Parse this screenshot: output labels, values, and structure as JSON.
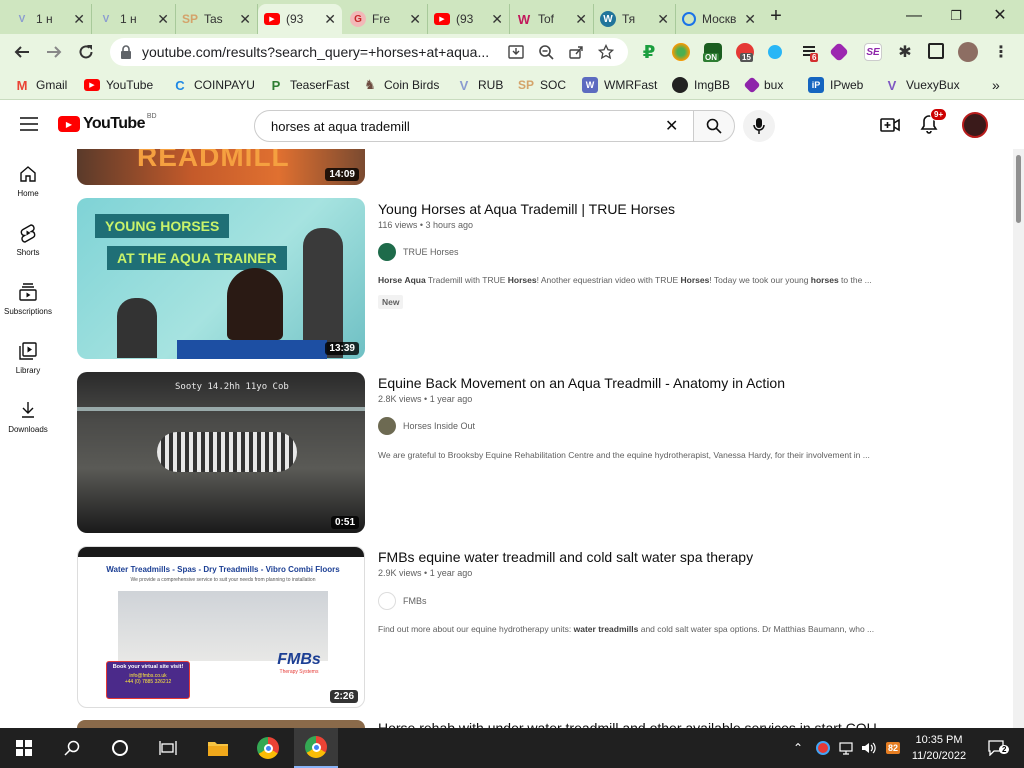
{
  "tabs": [
    {
      "title": "1 н",
      "icon": "v-icon",
      "color": "#8a9bd0",
      "letter": "V"
    },
    {
      "title": "1 н",
      "icon": "v-icon",
      "color": "#8a9bd0",
      "letter": "V"
    },
    {
      "title": "Tas",
      "icon": "sp-icon",
      "color": "#d4a36a",
      "letter": "SP"
    },
    {
      "title": "(93",
      "icon": "youtube-icon",
      "color": "#ff0000",
      "letter": "▶",
      "active": true
    },
    {
      "title": "Fre",
      "icon": "freebitco-icon",
      "color": "#e05a5a",
      "letter": "G"
    },
    {
      "title": "(93",
      "icon": "youtube-icon",
      "color": "#ff0000",
      "letter": "▶"
    },
    {
      "title": "Tof",
      "icon": "toloka-icon",
      "color": "#c2185b",
      "letter": "W"
    },
    {
      "title": "Тя",
      "icon": "wordpress-icon",
      "color": "#21759b",
      "letter": "W"
    },
    {
      "title": "Москв",
      "icon": "loader-icon",
      "color": "#1a73e8",
      "letter": "◯"
    }
  ],
  "address": {
    "url": "youtube.com/results?search_query=+horses+at+aqua..."
  },
  "extensions": {
    "badge_on": "ON",
    "badge_15": "15",
    "badge_6": "6",
    "badge_se": "SE"
  },
  "bookmarks": [
    {
      "label": "Gmail",
      "icon": "gmail-icon",
      "color": "#ea4335",
      "glyph": "M"
    },
    {
      "label": "YouTube",
      "icon": "youtube-icon",
      "color": "#ff0000",
      "glyph": "▶"
    },
    {
      "label": "COINPAYU",
      "icon": "coinpayu-icon",
      "color": "#1e88e5",
      "glyph": "C"
    },
    {
      "label": "TeaserFast",
      "icon": "teaserfast-icon",
      "color": "#2e7d32",
      "glyph": "P"
    },
    {
      "label": "Coin Birds",
      "icon": "coinbirds-icon",
      "color": "#6d4c41",
      "glyph": "♞"
    },
    {
      "label": "RUB",
      "icon": "v-icon",
      "color": "#8a9bd0",
      "glyph": "V"
    },
    {
      "label": "SOC",
      "icon": "sp-icon",
      "color": "#d4a36a",
      "glyph": "SP"
    },
    {
      "label": "WMRFast",
      "icon": "wmrfast-icon",
      "color": "#5c6bc0",
      "glyph": "W"
    },
    {
      "label": "ImgBB",
      "icon": "imgbb-icon",
      "color": "#222222",
      "glyph": "●"
    },
    {
      "label": "bux",
      "icon": "bux-icon",
      "color": "#8e24aa",
      "glyph": "◆"
    },
    {
      "label": "IPweb",
      "icon": "ipweb-icon",
      "color": "#1565c0",
      "glyph": "iP"
    },
    {
      "label": "VuexyBux",
      "icon": "vuexybux-icon",
      "color": "#7e57c2",
      "glyph": "V"
    }
  ],
  "youtube": {
    "logo_text": "YouTube",
    "region": "BD",
    "search_value": "horses at aqua trademill",
    "notif_count": "9+"
  },
  "sidebar": [
    {
      "label": "Home",
      "icon": "home-icon"
    },
    {
      "label": "Shorts",
      "icon": "shorts-icon"
    },
    {
      "label": "Subscriptions",
      "icon": "subscriptions-icon"
    },
    {
      "label": "Library",
      "icon": "library-icon"
    },
    {
      "label": "Downloads",
      "icon": "downloads-icon"
    }
  ],
  "top_partial": {
    "duration": "14:09",
    "thumb_text": "READMILL"
  },
  "results": [
    {
      "title": "Young Horses at Aqua Trademill | TRUE Horses",
      "views": "116 views",
      "age": "3 hours ago",
      "channel": "TRUE Horses",
      "duration": "13:39",
      "desc_parts": [
        "Horse",
        " ",
        "Aqua",
        " Trademill with TRUE ",
        "Horses",
        "! Another equestrian video with TRUE ",
        "Horses",
        "! Today we took our young ",
        "horses",
        " to the ..."
      ],
      "badge": "New",
      "thumb_line1": "YOUNG HORSES",
      "thumb_line2": "AT THE AQUA TRAINER"
    },
    {
      "title": "Equine Back Movement on an Aqua Treadmill - Anatomy in Action",
      "views": "2.8K views",
      "age": "1 year ago",
      "channel": "Horses Inside Out",
      "duration": "0:51",
      "desc": "We are grateful to Brooksby Equine Rehabilitation Centre and the equine hydrotherapist, Vanessa Hardy, for their involvement in ...",
      "thumb_caption": "Sooty 14.2hh 11yo Cob"
    },
    {
      "title": "FMBs equine water treadmill and cold salt water spa therapy",
      "views": "2.9K views",
      "age": "1 year ago",
      "channel": "FMBs",
      "duration": "2:26",
      "desc_parts": [
        "Find out more about our equine hydrotherapy units: ",
        "water treadmills",
        " and cold salt water spa options. Dr Matthias Baumann, who ..."
      ],
      "thumb_header": "Water Treadmills - Spas - Dry Treadmills - Vibro Combi Floors",
      "thumb_sub": "We provide a comprehensive service to suit your needs from planning to installation",
      "thumb_box1": "Book your virtual site visit!",
      "thumb_box2": "info@fmbs.co.uk",
      "thumb_box3": "+44 (0) 7885 326212",
      "thumb_logo": "FMBs",
      "thumb_logo_sub": "Therapy Systems"
    }
  ],
  "bottom_partial_title": "Horse rehab with under water treadmill and other available services in start COU",
  "taskbar": {
    "time": "10:35 PM",
    "date": "11/20/2022",
    "notif_count": "2",
    "tray_badge": "82"
  }
}
